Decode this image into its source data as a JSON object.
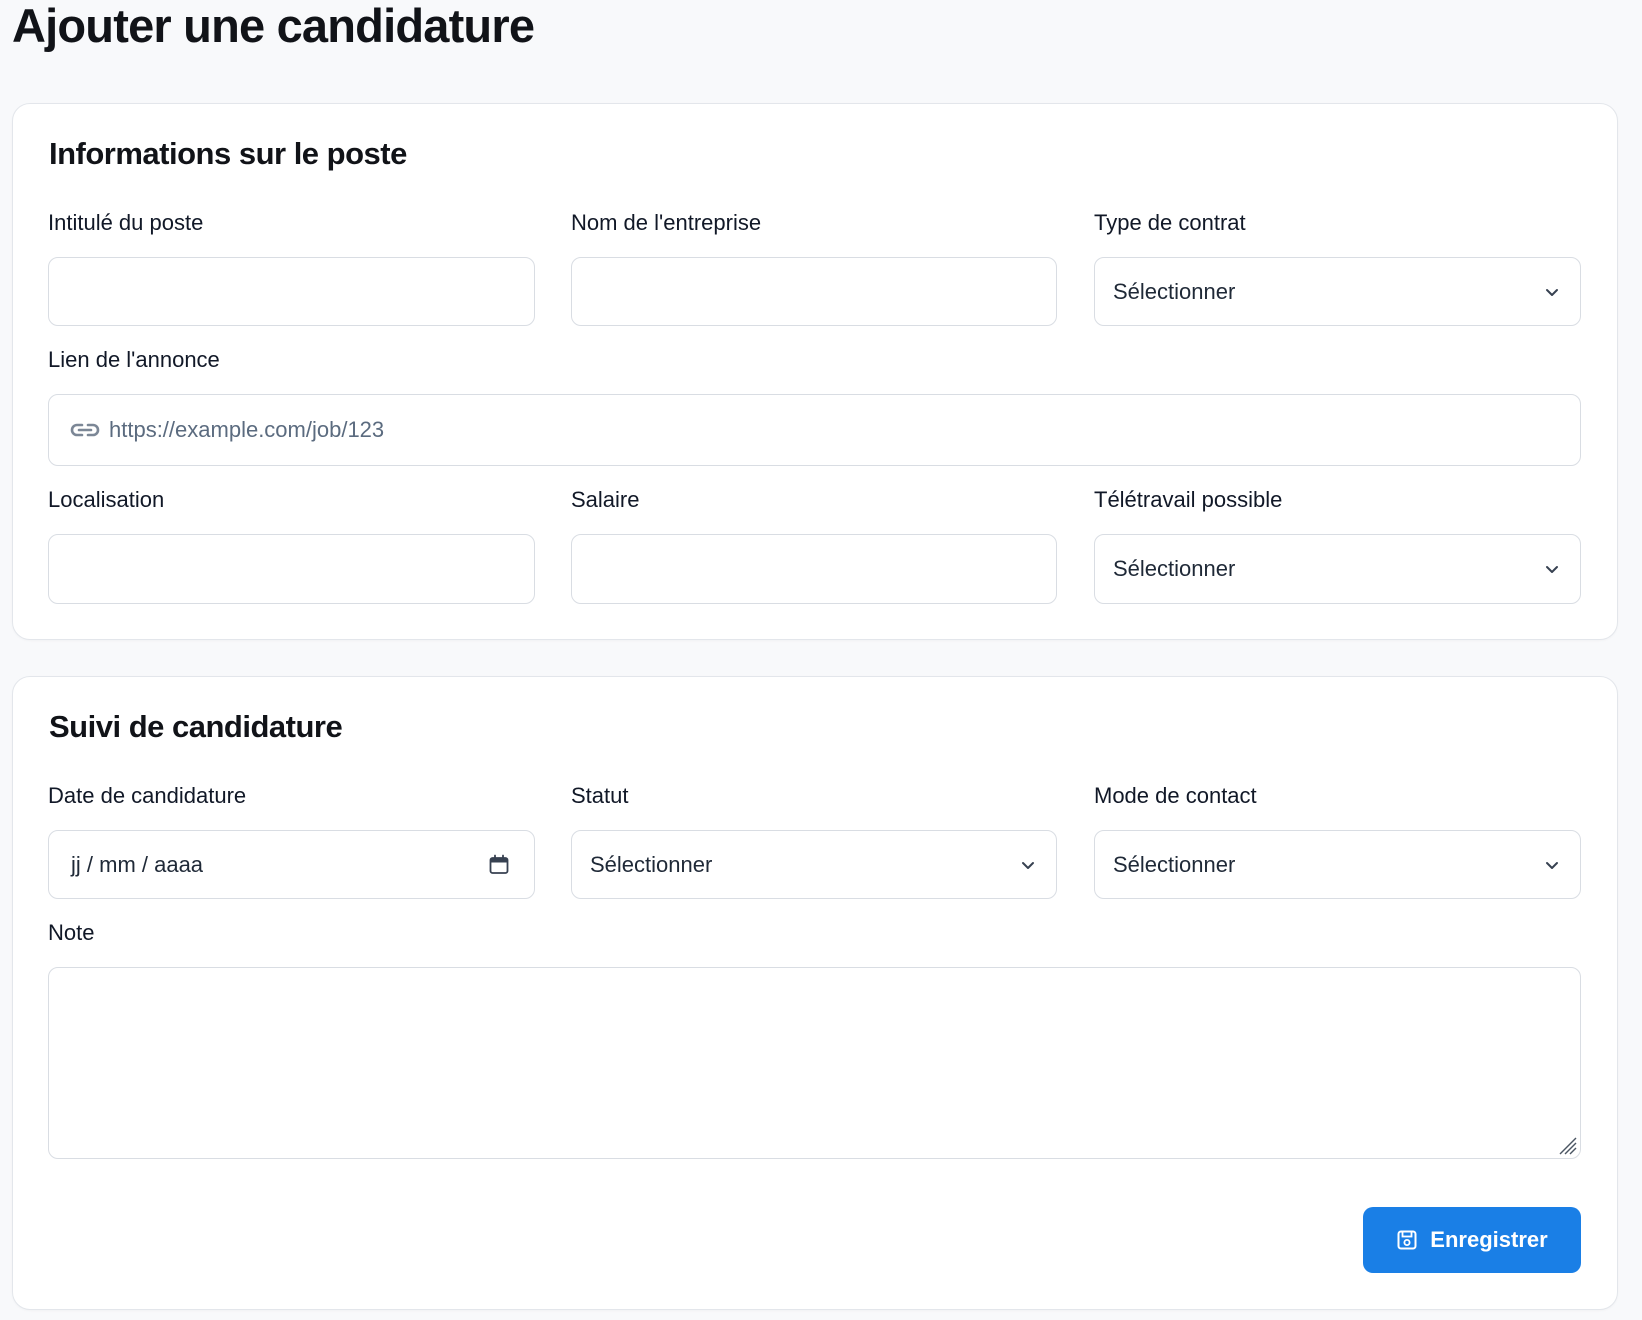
{
  "page": {
    "title": "Ajouter une candidature"
  },
  "job_info": {
    "title": "Informations sur le poste",
    "job_title_label": "Intitulé du poste",
    "job_title_value": "",
    "company_label": "Nom de l'entreprise",
    "company_value": "",
    "contract_type_label": "Type de contrat",
    "contract_type_value": "Sélectionner",
    "url_label": "Lien de l'annonce",
    "url_placeholder": "https://example.com/job/123",
    "url_value": "",
    "location_label": "Localisation",
    "location_value": "",
    "salary_label": "Salaire",
    "salary_value": "",
    "remote_label": "Télétravail possible",
    "remote_value": "Sélectionner"
  },
  "tracking": {
    "title": "Suivi de candidature",
    "date_label": "Date de candidature",
    "date_placeholder": "jj / mm / aaaa",
    "status_label": "Statut",
    "status_value": "Sélectionner",
    "contact_mode_label": "Mode de contact",
    "contact_mode_value": "Sélectionner",
    "note_label": "Note",
    "note_value": "",
    "save_label": "Enregistrer"
  },
  "colors": {
    "accent": "#1a7fe6",
    "page_background": "#f8f9fb",
    "card_background": "#ffffff",
    "border": "#d9dde3",
    "placeholder_text": "#5b6b7f"
  },
  "icons": {
    "url": "link-icon",
    "select": "chevron-down-icon",
    "date": "calendar-icon",
    "save": "floppy-disk-icon",
    "textarea_resize": "resize-handle-icon"
  }
}
